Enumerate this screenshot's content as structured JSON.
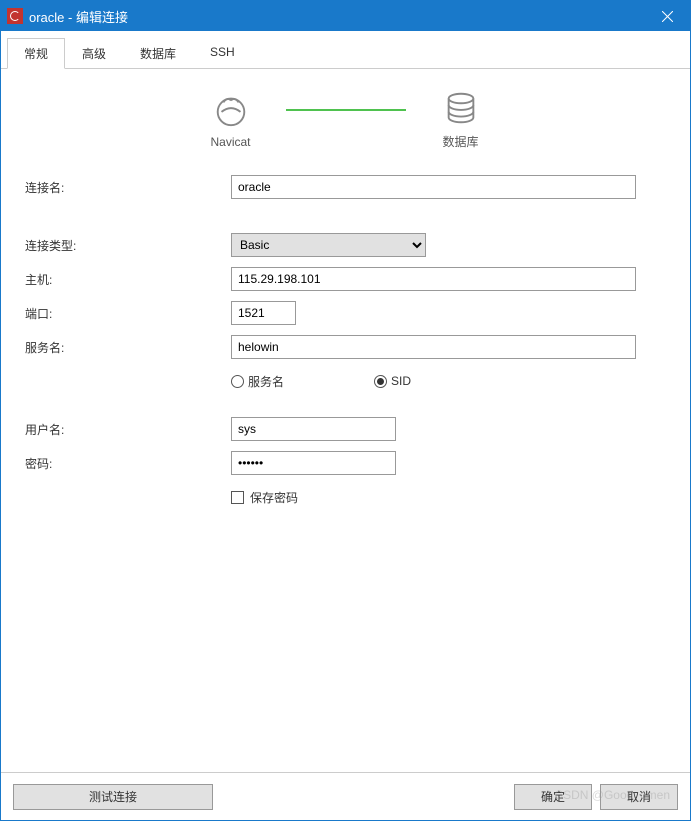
{
  "titlebar": {
    "title": "oracle - 编辑连接"
  },
  "tabs": [
    {
      "label": "常规",
      "active": true
    },
    {
      "label": "高级",
      "active": false
    },
    {
      "label": "数据库",
      "active": false
    },
    {
      "label": "SSH",
      "active": false
    }
  ],
  "diagram": {
    "left_label": "Navicat",
    "right_label": "数据库"
  },
  "form": {
    "connection_name_label": "连接名:",
    "connection_name_value": "oracle",
    "connection_type_label": "连接类型:",
    "connection_type_value": "Basic",
    "host_label": "主机:",
    "host_value": "115.29.198.101",
    "port_label": "端口:",
    "port_value": "1521",
    "service_name_label": "服务名:",
    "service_name_value": "helowin",
    "radio_service_label": "服务名",
    "radio_sid_label": "SID",
    "username_label": "用户名:",
    "username_value": "sys",
    "password_label": "密码:",
    "password_value": "••••••",
    "save_password_label": "保存密码"
  },
  "footer": {
    "test_label": "测试连接",
    "ok_label": "确定",
    "cancel_label": "取消"
  },
  "watermark": "CSDN @Good_omen"
}
